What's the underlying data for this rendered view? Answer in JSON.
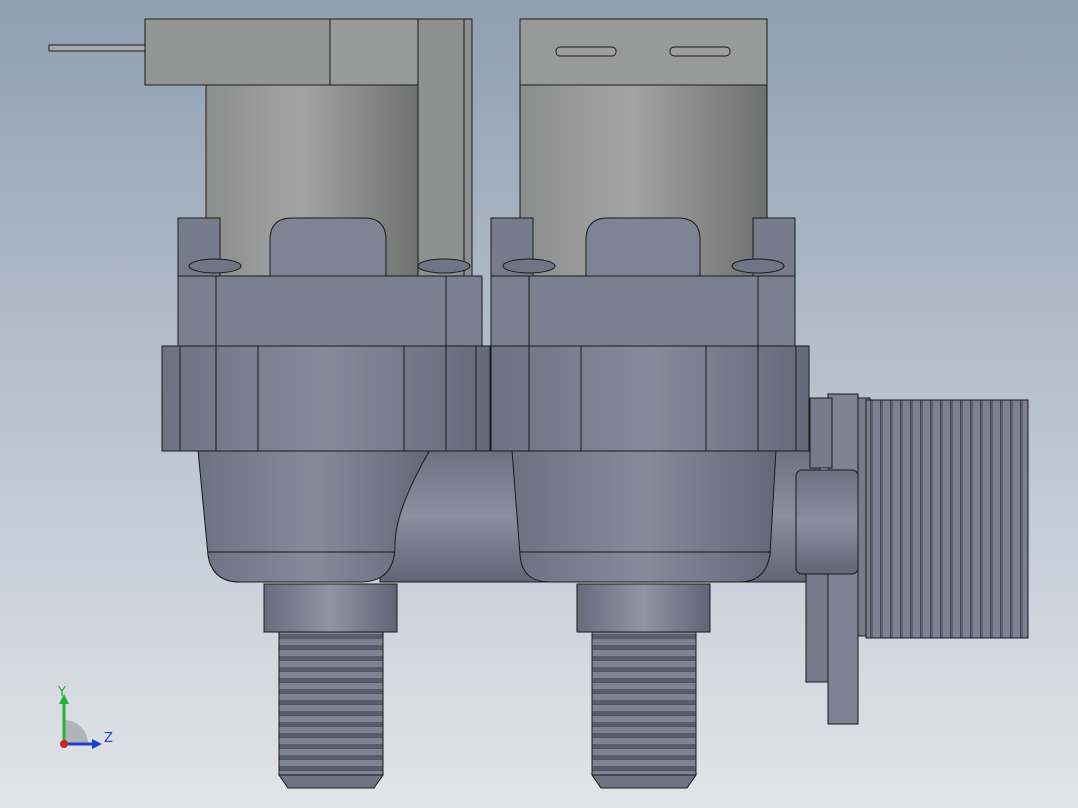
{
  "viewport": {
    "background_top": "#8f9fb1",
    "background_bottom": "#e2e5ea"
  },
  "model": {
    "body_color": "#7a808f",
    "coil_color": "#9a9b9b",
    "edge_color": "#1a1a1a"
  },
  "triad": {
    "y_label": "Y",
    "z_label": "Z",
    "y_color": "#22b33a",
    "z_color": "#1f3fd1",
    "x_color": "#d31f1f"
  }
}
